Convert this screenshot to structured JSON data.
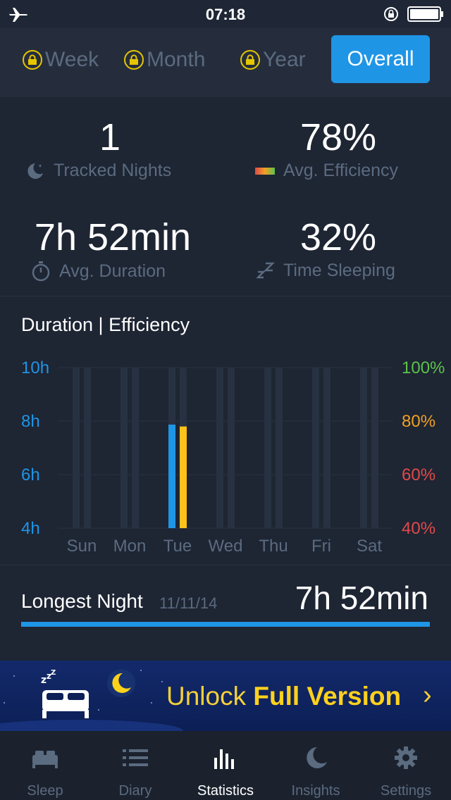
{
  "status": {
    "time": "07:18"
  },
  "tabs": {
    "week": "Week",
    "month": "Month",
    "year": "Year",
    "overall": "Overall"
  },
  "stats": {
    "tracked_nights": {
      "value": "1",
      "label": "Tracked Nights"
    },
    "avg_efficiency": {
      "value": "78%",
      "label": "Avg. Efficiency"
    },
    "avg_duration": {
      "value": "7h 52min",
      "label": "Avg. Duration"
    },
    "time_sleeping": {
      "value": "32%",
      "label": "Time Sleeping"
    }
  },
  "chart_title": "Duration | Efficiency",
  "chart_data": {
    "type": "bar",
    "categories": [
      "Sun",
      "Mon",
      "Tue",
      "Wed",
      "Thu",
      "Fri",
      "Sat"
    ],
    "series": [
      {
        "axis": "left",
        "color": "#1f95e6",
        "values": [
          null,
          null,
          7.87,
          null,
          null,
          null,
          null
        ]
      },
      {
        "axis": "right",
        "color": "#ffc21a",
        "values": [
          null,
          null,
          78,
          null,
          null,
          null,
          null
        ]
      }
    ],
    "left_axis": {
      "ticks": [
        "10h",
        "8h",
        "6h",
        "4h"
      ],
      "range": [
        4,
        10
      ],
      "color": "#1f95e6"
    },
    "right_axis": {
      "ticks": [
        {
          "label": "100%",
          "color": "#5cc24a"
        },
        {
          "label": "80%",
          "color": "#f0a024"
        },
        {
          "label": "60%",
          "color": "#e04a4a"
        },
        {
          "label": "40%",
          "color": "#e04a4a"
        }
      ],
      "range": [
        40,
        100
      ]
    },
    "grid": true
  },
  "longest_night": {
    "label": "Longest Night",
    "date": "11/11/14",
    "value": "7h 52min"
  },
  "banner": {
    "text_plain": "Unlock ",
    "text_bold": "Full Version",
    "chevron": "›"
  },
  "tab_bar": [
    {
      "label": "Sleep",
      "icon": "bed-icon"
    },
    {
      "label": "Diary",
      "icon": "list-icon"
    },
    {
      "label": "Statistics",
      "icon": "bar-chart-icon"
    },
    {
      "label": "Insights",
      "icon": "moon-icon"
    },
    {
      "label": "Settings",
      "icon": "gear-icon"
    }
  ],
  "colors": {
    "accent": "#1f95e6",
    "efficiency": "#ffc21a",
    "muted": "#5b6b80",
    "lock": "#e5c600"
  }
}
